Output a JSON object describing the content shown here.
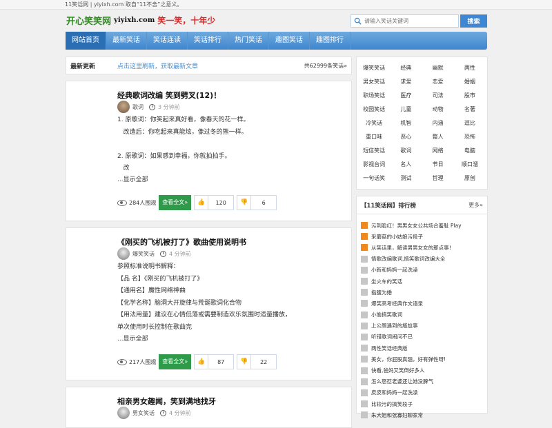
{
  "topbar": {
    "text": "11笑话网 | yiyixh.com 取自“11不舍”之意义。"
  },
  "logo": {
    "cn": "开心笑笑网",
    "domain": "yiyixh.com",
    "slogan": "笑一笑，十年少"
  },
  "search": {
    "placeholder": "请输入笑话关键词",
    "button": "搜索"
  },
  "nav": [
    "网站首页",
    "最新笑话",
    "笑话连读",
    "笑话排行",
    "热门笑话",
    "趣图笑话",
    "趣图排行"
  ],
  "latest": {
    "title": "最新更新",
    "refresh": "点击这里刷新，获取最新文章",
    "count": "共62999条笑话»"
  },
  "posts": [
    {
      "title": "经典歌词改编 笑到劈叉(12)！",
      "author": "歌词",
      "time": "3 分钟前",
      "body": "1. 原歌词：你笑起来真好看，像春天的花一样。\n   改造后：你吃起来真能炫，像过冬的熊一样。\n\n2. 原歌词：如果感到幸福，你就拍拍手。\n   改",
      "more": "...显示全部",
      "views": "284人围观",
      "read": "查看全文»",
      "likes": "120",
      "dislikes": "6"
    },
    {
      "title": "《刚买的飞机被打了》歌曲使用说明书",
      "author": "爆笑笑话",
      "time": "4 分钟前",
      "body": "参照标准说明书解释：\n【品 名】《刚买的飞机被打了》\n【通用名】魔性网络神曲\n【化学名称】脑洞大开旋律与荒诞歌词化合物\n【用法用量】建议在心情低落或需要制造欢乐氛围时适量播放，\n单次使用时长控制在歌曲完",
      "more": "...显示全部",
      "views": "217人围观",
      "read": "查看全文»",
      "likes": "87",
      "dislikes": "22"
    },
    {
      "title": "相亲男女趣闻，笑到满地找牙",
      "author": "男女笑话",
      "time": "4 分钟前"
    }
  ],
  "tags": [
    "爆笑笑话",
    "经典",
    "幽默",
    "两性",
    "男女笑话",
    "求爱",
    "恋爱",
    "婚姻",
    "职场笑话",
    "医疗",
    "司法",
    "股市",
    "校园笑话",
    "儿童",
    "动物",
    "名著",
    "冷笑话",
    "机智",
    "内涵",
    "逗比",
    "重口味",
    "恶心",
    "整人",
    "恐怖",
    "短信笑话",
    "歌词",
    "网络",
    "电脑",
    "影视台词",
    "名人",
    "节日",
    "顺口溜",
    "一句话笑",
    "测试",
    "哲理",
    "原创"
  ],
  "rank": {
    "title": "【11笑话网】排行榜",
    "more": "更多»",
    "items": [
      "污到脸红！男男女女公共场合羞耻 Play",
      "采蘑菇的小姑娘污段子",
      "从笑话里，解读男男女女的那点事！",
      "情歌改编歌词,搞笑歌词改编大全",
      "小新和妈妈一起洗澡",
      "坐火车的笑话",
      "指腹为婚",
      "爆笑高考经典作文语录",
      "小偷搞笑歌词",
      "上公厕遇到的尴尬事",
      "听错歌词闹问不已",
      "两性笑话经典版",
      "美女，你屁股真翘，好有弹性呀!",
      "快看,爸妈又笑倒好多人",
      "怎么怒怼老婆还让她没脾气",
      "皮皮和妈妈一起洗澡",
      "比较污的搞笑段子",
      "朱大姐和张寡妇聊家常"
    ]
  },
  "colors": {
    "nav": "#3e86cf",
    "read_button": "#2e9a4a",
    "rank_hot": "#f08a1f",
    "logo_green": "#2f8f1e",
    "slogan_red": "#d42b2b"
  }
}
